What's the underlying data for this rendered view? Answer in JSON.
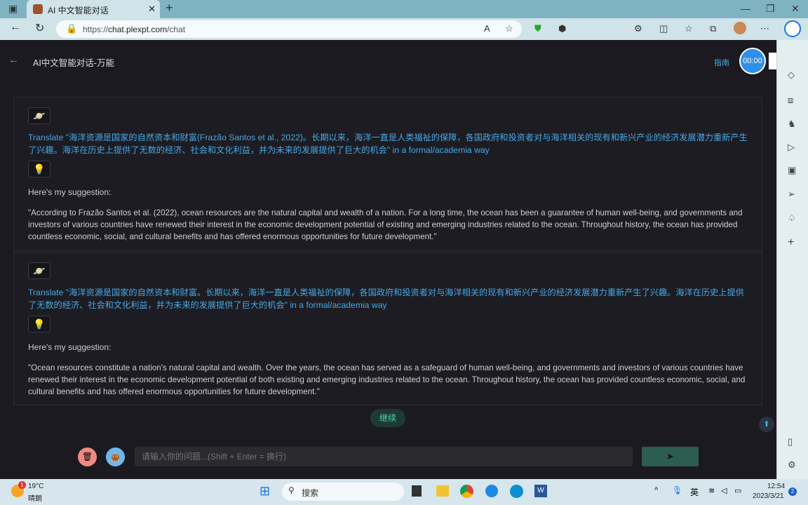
{
  "browser": {
    "tab_title": "AI 中文智能对话",
    "url_prefix": "https://",
    "url_host": "chat.plexpt.com",
    "url_path": "/chat"
  },
  "header": {
    "title": "AI中文智能对话-万能",
    "guide": "指南",
    "timer": "00:00"
  },
  "messages": [
    {
      "question": "Translate \"海洋资源是国家的自然资本和财富(Frazão Santos et al., 2022)。长期以来，海洋一直是人类福祉的保障，各国政府和投资者对与海洋相关的现有和新兴产业的经济发展潜力重新产生了兴趣。海洋在历史上提供了无数的经济、社会和文化利益，并为未来的发展提供了巨大的机会\" in a formal/academia way",
      "label": "Here's my suggestion:",
      "answer": "\"According to Frazão Santos et al. (2022), ocean resources are the natural capital and wealth of a nation. For a long time, the ocean has been a guarantee of human well-being, and governments and investors of various countries have renewed their interest in the economic development potential of existing and emerging industries related to the ocean. Throughout history, the ocean has provided countless economic, social, and cultural benefits and has offered enormous opportunities for future development.\""
    },
    {
      "question": "Translate \"海洋资源是国家的自然资本和财富。长期以来，海洋一直是人类福祉的保障，各国政府和投资者对与海洋相关的现有和新兴产业的经济发展潜力重新产生了兴趣。海洋在历史上提供了无数的经济、社会和文化利益，并为未来的发展提供了巨大的机会\" in a formal/academia way",
      "label": "Here's my suggestion:",
      "answer": "\"Ocean resources constitute a nation's natural capital and wealth. Over the years, the ocean has served as a safeguard of human well-being, and governments and investors of various countries have renewed their interest in the economic development potential of both existing and emerging industries related to the ocean. Throughout history, the ocean has provided countless economic, social, and cultural benefits and has offered enormous opportunities for future development.\""
    }
  ],
  "continue_label": "继续",
  "input": {
    "placeholder": "请输入你的问题...(Shift + Enter = 换行)"
  },
  "taskbar": {
    "temp": "19°C",
    "weather": "晴朗",
    "search": "搜索",
    "time": "12:54",
    "date": "2023/3/21",
    "lang": "英",
    "badge": "1",
    "notif": "2"
  }
}
